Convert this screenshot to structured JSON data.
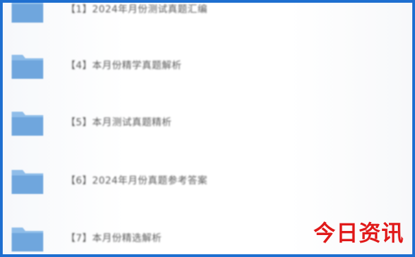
{
  "files": [
    {
      "label": "【1】2024年月份测试真题汇编",
      "icon": "folder-icon"
    },
    {
      "label": "【4】本月份精学真题解析",
      "icon": "folder-icon"
    },
    {
      "label": "【5】本月测试真题精析",
      "icon": "folder-icon"
    },
    {
      "label": "【6】2024年月份真题参考答案",
      "icon": "folder-icon"
    },
    {
      "label": "【7】本月份精选解析",
      "icon": "folder-icon"
    }
  ],
  "watermark": "今日资讯",
  "colors": {
    "border": "#1e6fd0",
    "folder": "#7fb2e5",
    "watermark": "#e01a1a"
  }
}
